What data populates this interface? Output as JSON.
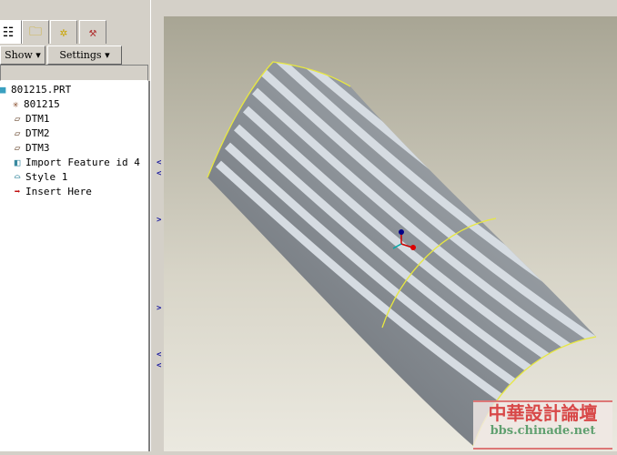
{
  "toolbar": {
    "show_label": "Show",
    "settings_label": "Settings"
  },
  "tabs": [
    {
      "icon": "model-tree-icon"
    },
    {
      "icon": "layers-folder-icon"
    },
    {
      "icon": "folder-star-icon"
    },
    {
      "icon": "tools-folder-icon"
    }
  ],
  "tree": {
    "items": [
      {
        "label": "801215.PRT",
        "icon": "part-icon"
      },
      {
        "label": "801215",
        "icon": "csys-icon"
      },
      {
        "label": "DTM1",
        "icon": "datum-plane-icon"
      },
      {
        "label": "DTM2",
        "icon": "datum-plane-icon"
      },
      {
        "label": "DTM3",
        "icon": "datum-plane-icon"
      },
      {
        "label": "Import Feature id 4",
        "icon": "import-feature-icon"
      },
      {
        "label": "Style 1",
        "icon": "style-surface-icon"
      },
      {
        "label": "Insert Here",
        "icon": "insert-arrow-icon"
      }
    ]
  },
  "watermark": {
    "title": "中華設計論壇",
    "url": "bbs.chinade.net"
  }
}
